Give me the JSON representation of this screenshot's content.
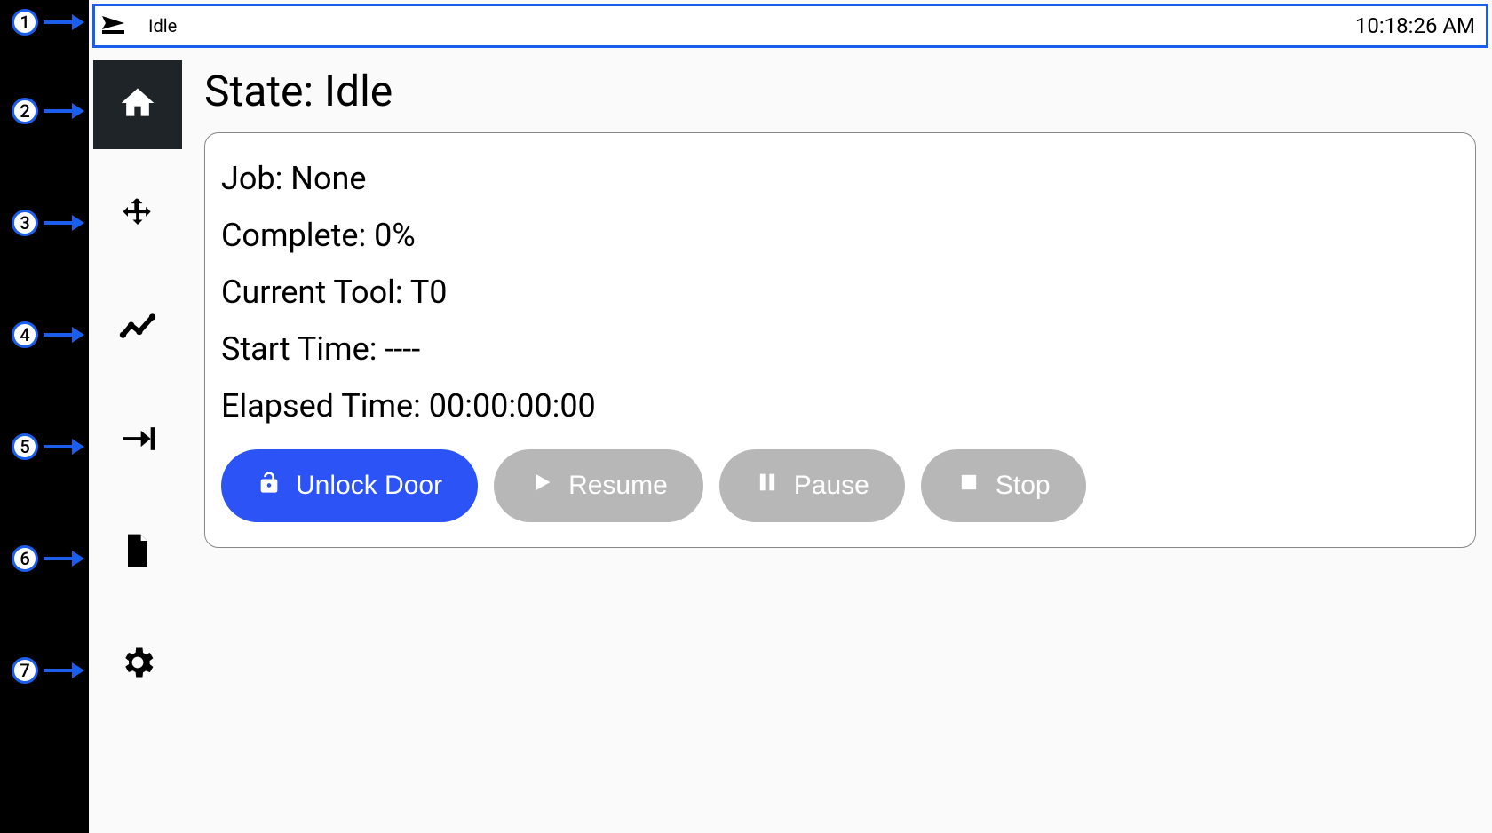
{
  "callouts": [
    "1",
    "2",
    "3",
    "4",
    "5",
    "6",
    "7"
  ],
  "topbar": {
    "status": "Idle",
    "time": "10:18:26 AM"
  },
  "sidebar": {
    "items": [
      {
        "name": "home-icon",
        "active": true
      },
      {
        "name": "move-icon",
        "active": false
      },
      {
        "name": "chart-icon",
        "active": false
      },
      {
        "name": "arrow-right-bar-icon",
        "active": false
      },
      {
        "name": "file-icon",
        "active": false
      },
      {
        "name": "gear-icon",
        "active": false
      }
    ]
  },
  "state": {
    "title_prefix": "State: ",
    "title_value": "Idle",
    "job_label": "Job: ",
    "job_value": "None",
    "complete_label": "Complete: ",
    "complete_value": "0%",
    "tool_label": "Current Tool: ",
    "tool_value": "T0",
    "start_label": "Start Time: ",
    "start_value": "----",
    "elapsed_label": "Elapsed Time: ",
    "elapsed_value": "00:00:00:00"
  },
  "buttons": {
    "unlock": "Unlock Door",
    "resume": "Resume",
    "pause": "Pause",
    "stop": "Stop"
  },
  "colors": {
    "accent": "#2b53f6",
    "callout_border": "#1b5eec",
    "disabled": "#b7b7b7",
    "sidebar_active": "#1f2428"
  }
}
